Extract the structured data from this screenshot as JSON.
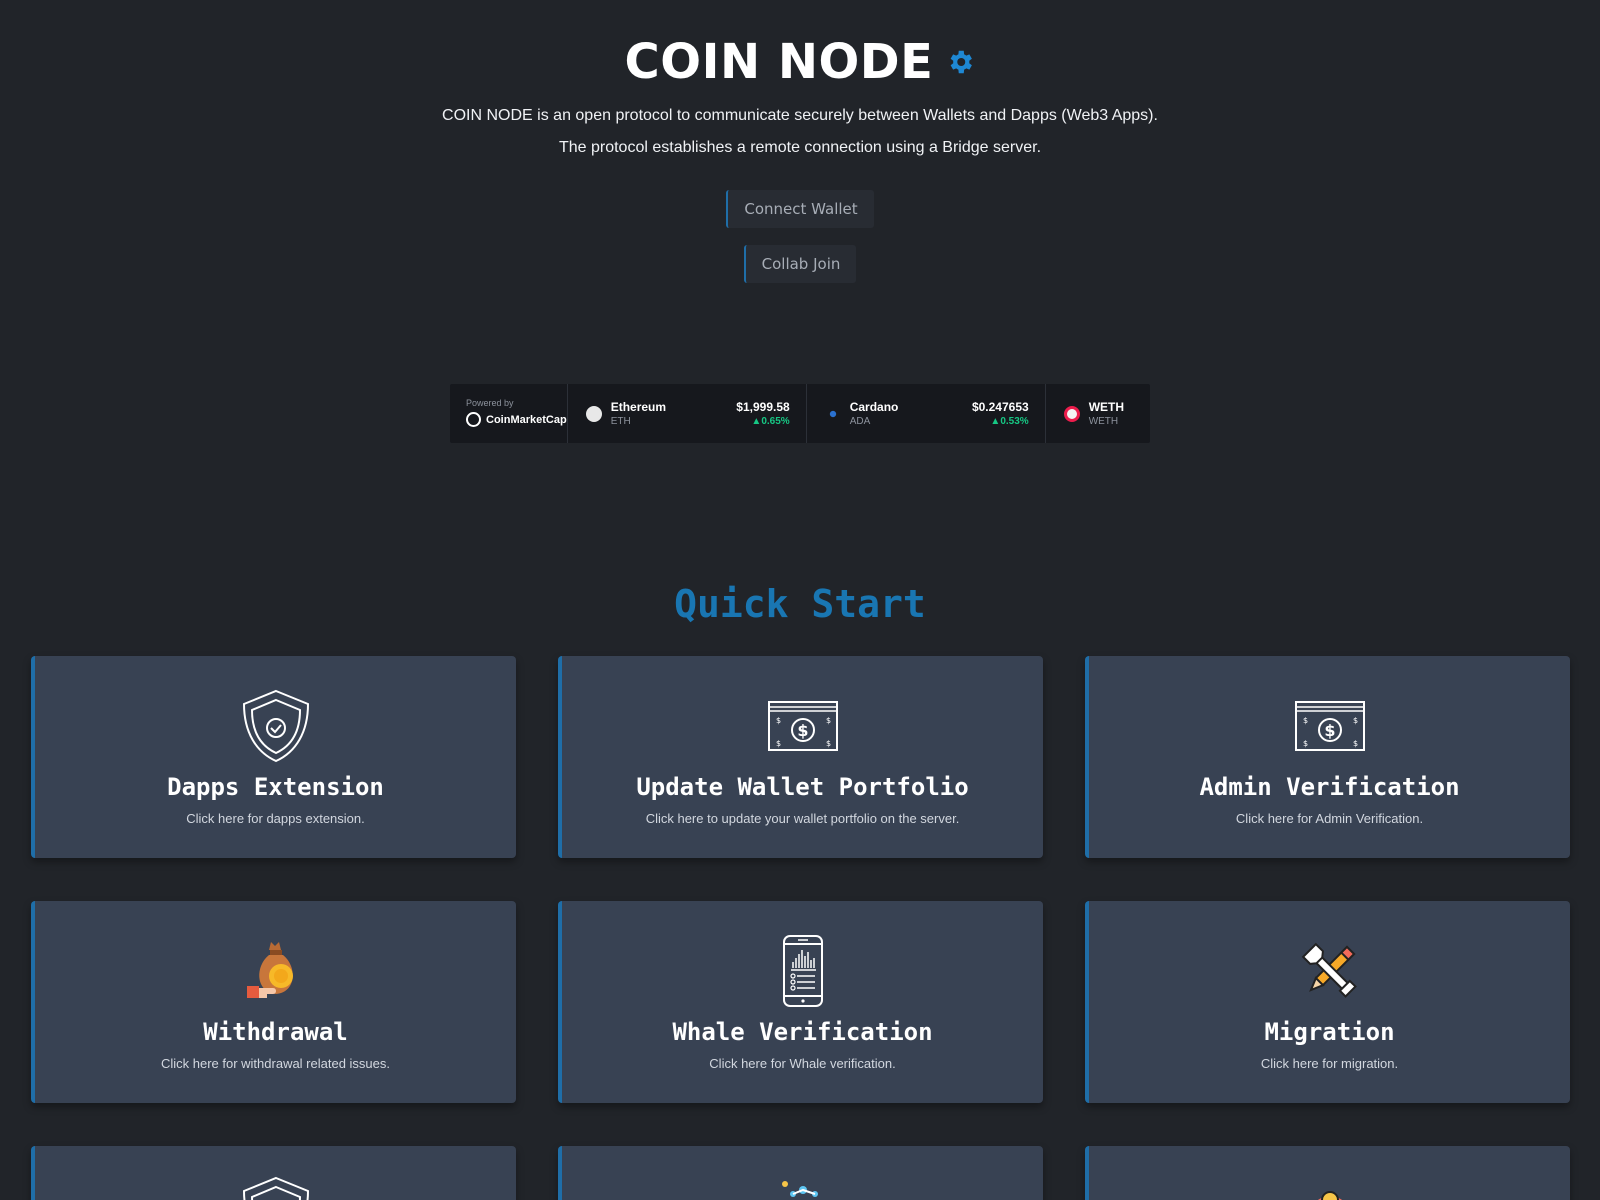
{
  "header": {
    "brand": "COIN NODE",
    "description_line1": "COIN NODE is an open protocol to communicate securely between Wallets and Dapps (Web3 Apps).",
    "description_line2": "The protocol establishes a remote connection using a Bridge server.",
    "connect_wallet_label": "Connect Wallet",
    "collab_join_label": "Collab Join"
  },
  "ticker": {
    "powered_by": "Powered by",
    "provider": "CoinMarketCap",
    "coins": [
      {
        "name": "Ethereum",
        "symbol": "ETH",
        "price": "$1,999.58",
        "change": "0.65%"
      },
      {
        "name": "Cardano",
        "symbol": "ADA",
        "price": "$0.247653",
        "change": "0.53%"
      },
      {
        "name": "WETH",
        "symbol": "WETH",
        "price": "",
        "change": ""
      }
    ]
  },
  "quick_start": {
    "title": "Quick Start",
    "cards": [
      {
        "title": "Dapps Extension",
        "subtitle": "Click here for dapps extension.",
        "icon": "shield-check-icon"
      },
      {
        "title": "Update Wallet Portfolio",
        "subtitle": "Click here to update your wallet portfolio on the server.",
        "icon": "banknote-icon"
      },
      {
        "title": "Admin Verification",
        "subtitle": "Click here for Admin Verification.",
        "icon": "banknote-icon"
      },
      {
        "title": "Withdrawal",
        "subtitle": "Click here for withdrawal related issues.",
        "icon": "money-bag-icon"
      },
      {
        "title": "Whale Verification",
        "subtitle": "Click here for Whale verification.",
        "icon": "phone-chart-icon"
      },
      {
        "title": "Migration",
        "subtitle": "Click here for migration.",
        "icon": "tools-icon"
      }
    ]
  },
  "colors": {
    "background": "#212429",
    "card": "#384253",
    "accent": "#1976b2",
    "positive": "#16c784"
  }
}
